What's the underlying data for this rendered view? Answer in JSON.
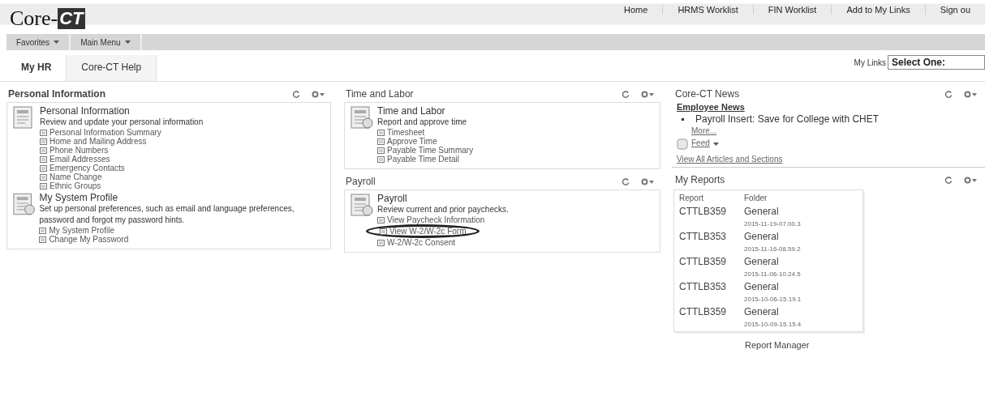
{
  "logo": {
    "text": "Core-",
    "mark": "CT"
  },
  "nav": [
    "Home",
    "HRMS Worklist",
    "FIN Worklist",
    "Add to My Links",
    "Sign ou"
  ],
  "menus": [
    "Favorites",
    "Main Menu"
  ],
  "tabs": [
    {
      "label": "My HR",
      "selected": true
    },
    {
      "label": "Core-CT Help",
      "selected": false
    }
  ],
  "my_links": {
    "label": "My Links",
    "value": "Select One:"
  },
  "columns": [
    [
      {
        "title": "Personal Information",
        "kind": "sections",
        "sections": [
          {
            "title": "Personal Information",
            "desc": "Review and update your personal information",
            "links": [
              {
                "label": "Personal Information Summary",
                "circled": false
              },
              {
                "label": "Home and Mailing Address",
                "circled": false
              },
              {
                "label": "Phone Numbers",
                "circled": false
              },
              {
                "label": "Email Addresses",
                "circled": false
              },
              {
                "label": "Emergency Contacts",
                "circled": false
              },
              {
                "label": "Name Change",
                "circled": false
              },
              {
                "label": "Ethnic Groups",
                "circled": false
              }
            ]
          },
          {
            "title": "My System Profile",
            "desc": "Set up personal preferences, such as email and language preferences, password and forgot my password hints.",
            "links": [
              {
                "label": "My System Profile",
                "circled": false
              },
              {
                "label": "Change My Password",
                "circled": false
              }
            ]
          }
        ]
      }
    ],
    [
      {
        "title": "Time and Labor",
        "kind": "sections",
        "sections": [
          {
            "title": "Time and Labor",
            "desc": "Report and approve time",
            "links": [
              {
                "label": "Timesheet",
                "circled": false
              },
              {
                "label": "Approve Time",
                "circled": false
              },
              {
                "label": "Payable Time Summary",
                "circled": false
              },
              {
                "label": "Payable Time Detail",
                "circled": false
              }
            ]
          }
        ]
      },
      {
        "title": "Payroll",
        "kind": "sections",
        "sections": [
          {
            "title": "Payroll",
            "desc": "Review current and prior paychecks.",
            "links": [
              {
                "label": "View Paycheck Information",
                "circled": false
              },
              {
                "label": "View W-2/W-2c Form",
                "circled": true
              },
              {
                "label": "W-2/W-2c Consent",
                "circled": false
              }
            ]
          }
        ]
      }
    ],
    [
      {
        "title": "Core-CT News",
        "kind": "news",
        "heading": "Employee News",
        "items": [
          "Payroll Insert: Save for College with CHET"
        ],
        "more": "More...",
        "feed": "Feed",
        "view_all": "View All Articles and Sections"
      },
      {
        "title": "My Reports",
        "kind": "reports",
        "columns": [
          "Report",
          "Folder"
        ],
        "rows": [
          {
            "report": "CTTLB359",
            "folder": "General",
            "date": "2015-11-19-07.00.3"
          },
          {
            "report": "CTTLB353",
            "folder": "General",
            "date": "2015-11-16-08.59.2"
          },
          {
            "report": "CTTLB359",
            "folder": "General",
            "date": "2015-11-06-10.24.5"
          },
          {
            "report": "CTTLB353",
            "folder": "General",
            "date": "2015-10-06-15.19.1"
          },
          {
            "report": "CTTLB359",
            "folder": "General",
            "date": "2015-10-09-15.15.4"
          }
        ],
        "footer": "Report Manager"
      }
    ]
  ]
}
